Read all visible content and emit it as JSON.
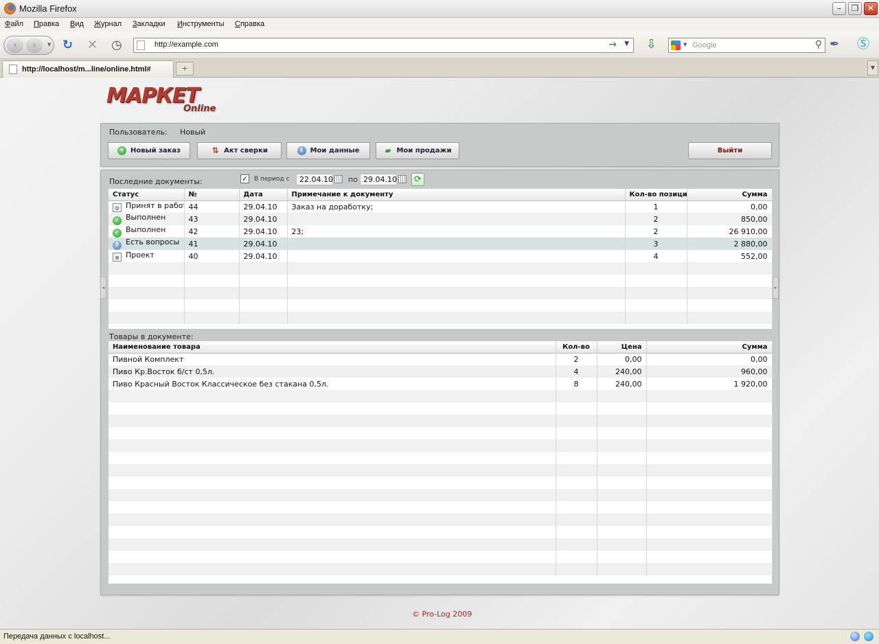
{
  "window": {
    "title": "Mozilla Firefox"
  },
  "menu": [
    "Файл",
    "Правка",
    "Вид",
    "Журнал",
    "Закладки",
    "Инструменты",
    "Справка"
  ],
  "nav": {
    "url": "http://example.com",
    "search_placeholder": "Google"
  },
  "tab": {
    "label": "http://localhost/m...line/online.html#"
  },
  "logo": {
    "main": "МАРКЕТ",
    "sub": "Online"
  },
  "user": {
    "label": "Пользователь:",
    "value": "Новый"
  },
  "toolbar": {
    "new_order": "Новый заказ",
    "reconciliation": "Акт сверки",
    "my_data": "Мои данные",
    "my_sales": "Мои продажи",
    "exit": "Выйти"
  },
  "documents": {
    "title": "Последние документы:",
    "period_label": "В период с",
    "date_from": "22.04.10",
    "to_label": "по",
    "date_to": "29.04.10",
    "period_checked": true,
    "columns": [
      "Статус",
      "№",
      "Дата",
      "Примечание к документу",
      "Кол-во позиций",
      "Сумма"
    ],
    "rows": [
      {
        "status": "Принят в работу",
        "status_icon": "document-gear-icon",
        "num": "44",
        "date": "29.04.10",
        "note": "Заказ на доработку;",
        "qty": "1",
        "sum": "0,00"
      },
      {
        "status": "Выполнен",
        "status_icon": "check-circle-icon",
        "num": "43",
        "date": "29.04.10",
        "note": "",
        "qty": "2",
        "sum": "850,00"
      },
      {
        "status": "Выполнен",
        "status_icon": "check-circle-icon",
        "num": "42",
        "date": "29.04.10",
        "note": "23;",
        "qty": "2",
        "sum": "26 910,00"
      },
      {
        "status": "Есть вопросы",
        "status_icon": "question-circle-icon",
        "num": "41",
        "date": "29.04.10",
        "note": "",
        "qty": "3",
        "sum": "2 880,00"
      },
      {
        "status": "Проект",
        "status_icon": "document-draft-icon",
        "num": "40",
        "date": "29.04.10",
        "note": "",
        "qty": "4",
        "sum": "552,00"
      }
    ],
    "selected_row": 3
  },
  "goods": {
    "title": "Товары в документе:",
    "columns": [
      "Наименование товара",
      "Кол-во",
      "Цена",
      "Сумма"
    ],
    "rows": [
      {
        "name": "Пивной Комплект",
        "qty": "2",
        "price": "0,00",
        "sum": "0,00"
      },
      {
        "name": "Пиво Кр.Восток б/ст 0,5л.",
        "qty": "4",
        "price": "240,00",
        "sum": "960,00"
      },
      {
        "name": "Пиво Красный Восток Классическое без стакана 0,5л.",
        "qty": "8",
        "price": "240,00",
        "sum": "1 920,00"
      }
    ]
  },
  "footer": {
    "copyright": "© Pro-Log 2009"
  },
  "status_bar": {
    "text": "Передача данных с localhost..."
  }
}
